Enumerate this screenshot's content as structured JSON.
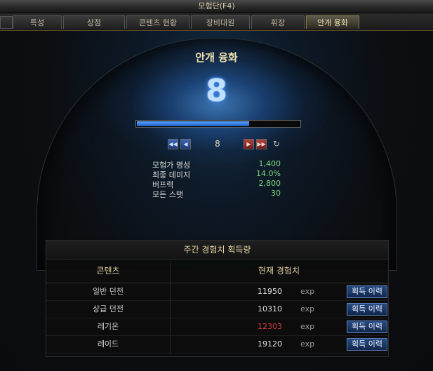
{
  "window": {
    "title": "모험단(F4)"
  },
  "tabs": [
    {
      "label": "특성",
      "active": false
    },
    {
      "label": "상점",
      "active": false
    },
    {
      "label": "콘텐츠 현황",
      "active": false
    },
    {
      "label": "장비대원",
      "active": false
    },
    {
      "label": "휘장",
      "active": false
    },
    {
      "label": "안개 융화",
      "active": true
    }
  ],
  "fusion": {
    "title": "안개 융화",
    "level": "8",
    "progress": 0.69,
    "nav_level": "8",
    "stats": [
      {
        "label": "모험가 명성",
        "value": "1,400"
      },
      {
        "label": "최종 데미지",
        "value": "14.0%"
      },
      {
        "label": "버프력",
        "value": "2,800"
      },
      {
        "label": "모든 스탯",
        "value": "30"
      }
    ]
  },
  "weekly": {
    "title": "주간 경험치 획득량",
    "col_content": "콘텐츠",
    "col_exp": "현재 경험치",
    "rows": [
      {
        "content": "일반 던전",
        "exp": "11950",
        "unit": "exp",
        "button": "획득 이력",
        "highlight": false
      },
      {
        "content": "상급 던전",
        "exp": "10310",
        "unit": "exp",
        "button": "획득 이력",
        "highlight": false
      },
      {
        "content": "레기온",
        "exp": "12303",
        "unit": "exp",
        "button": "획득 이력",
        "highlight": true
      },
      {
        "content": "레이드",
        "exp": "19120",
        "unit": "exp",
        "button": "획득 이력",
        "highlight": false
      }
    ]
  },
  "colors": {
    "accent": "#f0e2b0",
    "stat_value": "#7bd67b",
    "highlight_exp": "#d13a3a"
  }
}
